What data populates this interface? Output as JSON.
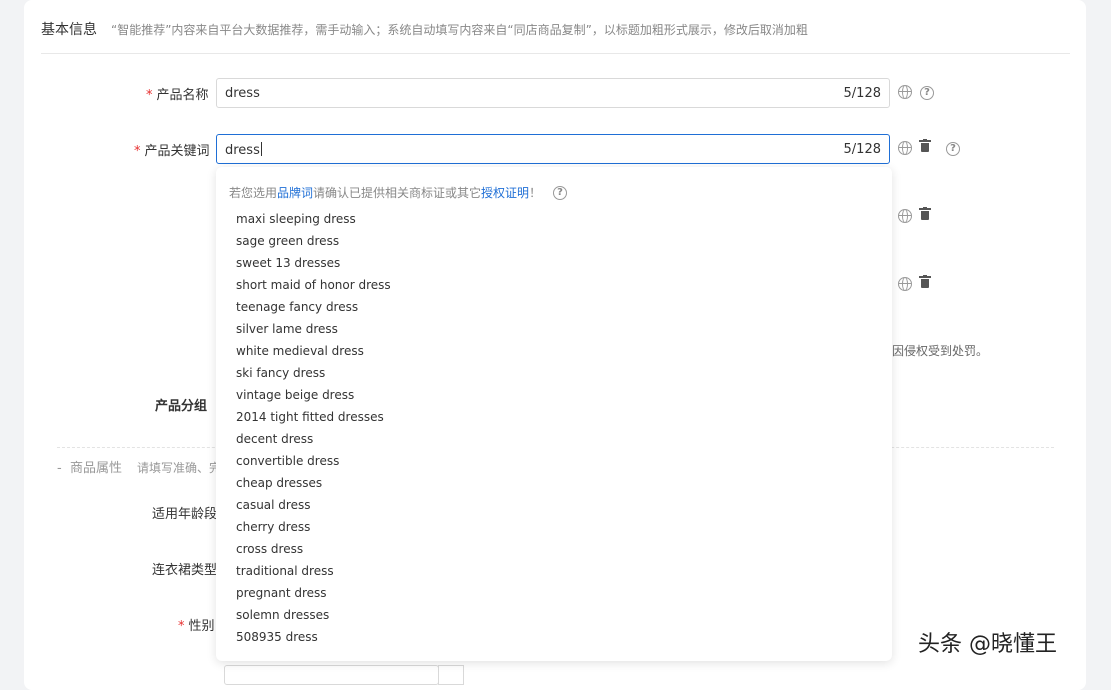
{
  "section": {
    "title": "基本信息",
    "description": "“智能推荐”内容来自平台大数据推荐，需手动输入；系统自动填写内容来自“同店商品复制”，以标题加粗形式展示，修改后取消加粗"
  },
  "product_name": {
    "label": "产品名称",
    "value": "dress",
    "counter": "5/128"
  },
  "product_keyword": {
    "label": "产品关键词",
    "value": "dress",
    "counter": "5/128"
  },
  "dropdown": {
    "tip_before": "若您选用",
    "tip_link1": "品牌词",
    "tip_middle": "请确认已提供相关商标证或其它",
    "tip_link2": "授权证明",
    "tip_after": "！",
    "suggestions": [
      "maxi sleeping dress",
      "sage green dress",
      "sweet 13 dresses",
      "short maid of honor dress",
      "teenage fancy dress",
      "silver lame dress",
      "white medieval dress",
      "ski fancy dress",
      "vintage beige dress",
      "2014 tight fitted dresses",
      "decent dress",
      "convertible dress",
      "cheap dresses",
      "casual dress",
      "cherry dress",
      "cross dress",
      "traditional dress",
      "pregnant dress",
      "solemn dresses",
      "508935 dress"
    ]
  },
  "hidden_note_tail": "因侵权受到处罚。",
  "product_group_label": "产品分组",
  "attributes": {
    "title": "商品属性",
    "desc_partial": "请填写准确、完"
  },
  "fields": {
    "age_label": "适用年龄段:",
    "dress_type_label": "连衣裙类型:",
    "gender_label": "性别:"
  },
  "watermark": "头条 @晓懂王",
  "colors": {
    "accent": "#1f6fd6",
    "required": "#e62e2e"
  }
}
